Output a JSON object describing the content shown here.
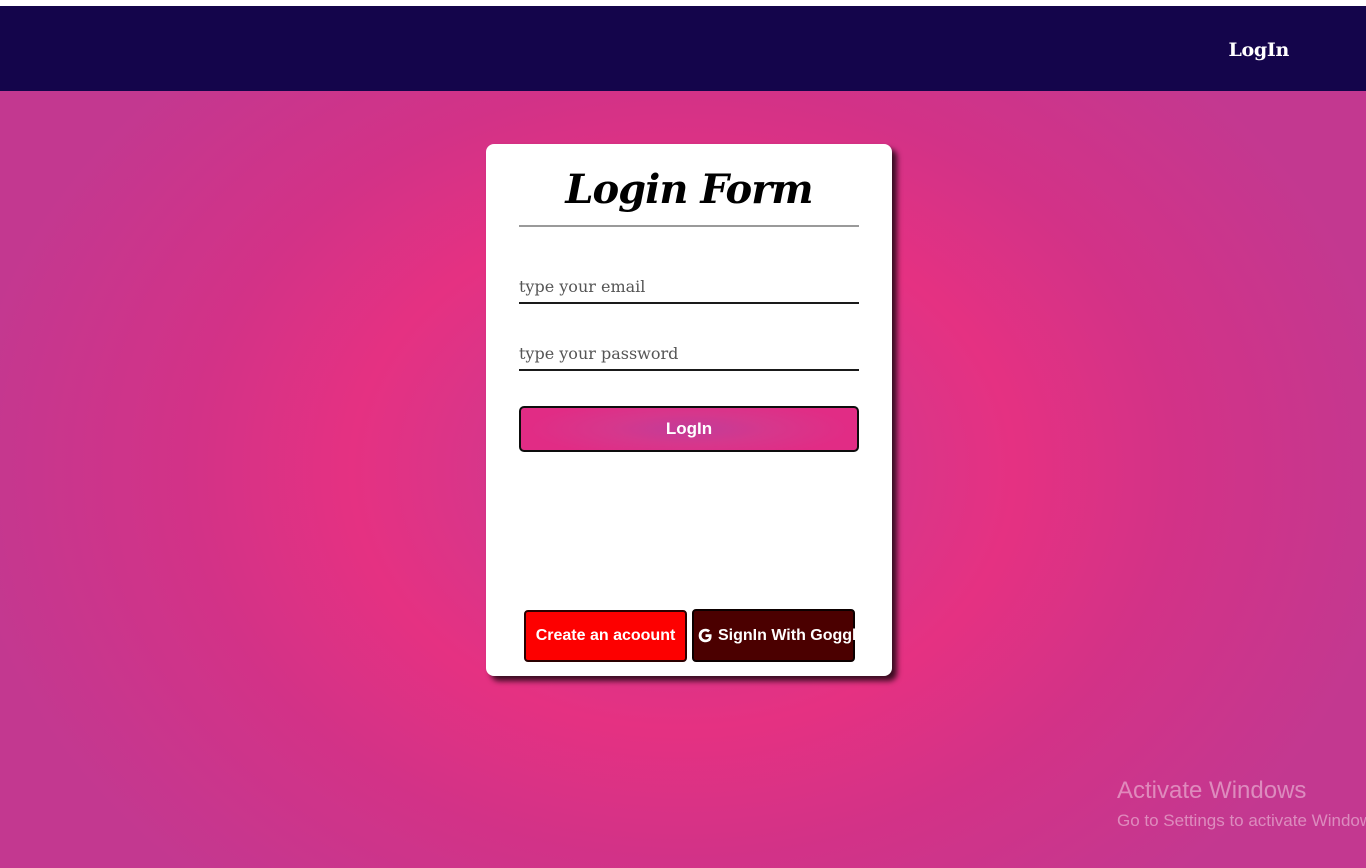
{
  "navbar": {
    "login_label": "LogIn",
    "bg_color": "#14054b"
  },
  "login_form": {
    "title": "Login Form",
    "email_placeholder": "type your email",
    "password_placeholder": "type your password",
    "login_button_label": "LogIn",
    "create_account_label": "Create an acoount",
    "google_signin_label": "SignIn With Goggle",
    "google_icon": "google-icon",
    "create_account_color": "#fd0000",
    "google_button_color": "#4b0000"
  },
  "windows_watermark": {
    "title": "Activate Windows",
    "subtitle": "Go to Settings to activate Windows."
  },
  "theme": {
    "background_pink": "#e53182",
    "background_purple": "#c43590"
  }
}
